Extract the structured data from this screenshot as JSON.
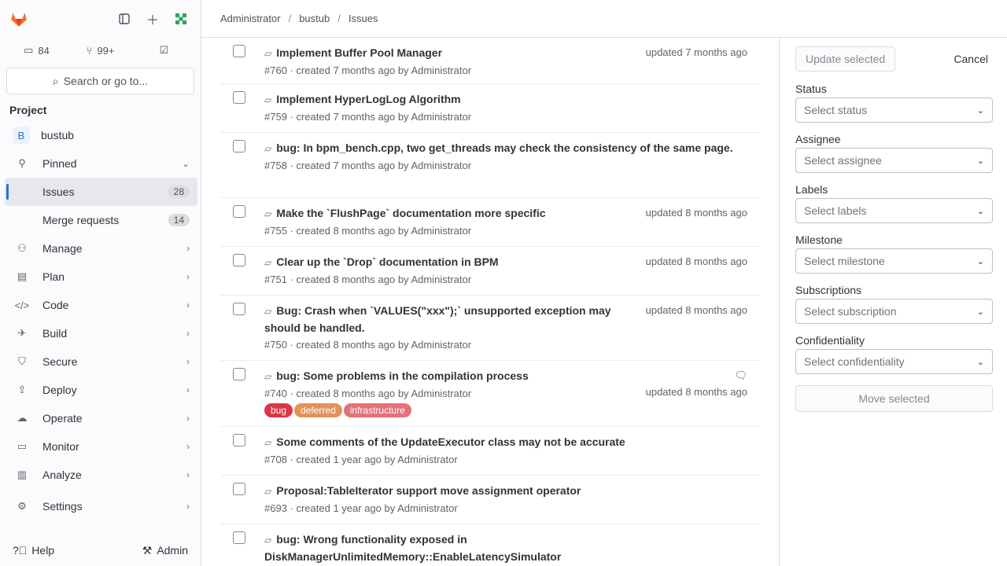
{
  "header": {
    "breadcrumbs": [
      "Administrator",
      "bustub",
      "Issues"
    ]
  },
  "sidebar": {
    "counters": [
      {
        "icon": "issues-icon",
        "value": "84"
      },
      {
        "icon": "merge-request-icon",
        "value": "99+"
      },
      {
        "icon": "todo-icon",
        "value": ""
      }
    ],
    "search_label": "Search or go to...",
    "section_title": "Project",
    "project": {
      "avatar": "B",
      "name": "bustub"
    },
    "items": [
      {
        "label": "Pinned"
      },
      {
        "label": "Issues",
        "badge": "28"
      },
      {
        "label": "Merge requests",
        "badge": "14"
      },
      {
        "label": "Manage"
      },
      {
        "label": "Plan"
      },
      {
        "label": "Code"
      },
      {
        "label": "Build"
      },
      {
        "label": "Secure"
      },
      {
        "label": "Deploy"
      },
      {
        "label": "Operate"
      },
      {
        "label": "Monitor"
      },
      {
        "label": "Analyze"
      },
      {
        "label": "Settings"
      }
    ],
    "help_label": "Help",
    "admin_label": "Admin"
  },
  "issues": [
    {
      "title": "Implement Buffer Pool Manager",
      "meta": "#760 · created 7 months ago by Administrator",
      "updated": "updated 7 months ago"
    },
    {
      "title": "Implement HyperLogLog Algorithm",
      "meta": "#759 · created 7 months ago by Administrator",
      "updated": ""
    },
    {
      "title": "bug: In bpm_bench.cpp, two get_threads may check the consistency of the same page.",
      "meta": "#758 · created 7 months ago by Administrator",
      "updated": ""
    },
    {
      "title": "Make the `FlushPage` documentation more specific",
      "meta": "#755 · created 8 months ago by Administrator",
      "updated": "updated 8 months ago"
    },
    {
      "title": "Clear up the `Drop` documentation in BPM",
      "meta": "#751 · created 8 months ago by Administrator",
      "updated": "updated 8 months ago"
    },
    {
      "title": "Bug: Crash when `VALUES(\"xxx\");` unsupported exception may should be handled.",
      "meta": "#750 · created 8 months ago by Administrator",
      "updated": "updated 8 months ago"
    },
    {
      "title": "bug: Some problems in the compilation process",
      "meta": "#740 · created 8 months ago by Administrator",
      "updated": "updated 8 months ago",
      "labels": [
        {
          "text": "bug",
          "color": "#dc3545"
        },
        {
          "text": "deferred",
          "color": "#e4915c"
        },
        {
          "text": "infrastructure",
          "color": "#e37278"
        }
      ]
    },
    {
      "title": "Some comments of the UpdateExecutor class may not be accurate",
      "meta": "#708 · created 1 year ago by Administrator",
      "updated": ""
    },
    {
      "title": "Proposal:TableIterator support move assignment operator",
      "meta": "#693 · created 1 year ago by Administrator",
      "updated": ""
    },
    {
      "title": "bug: Wrong functionality exposed in DiskManagerUnlimitedMemory::EnableLatencySimulator",
      "meta": "",
      "updated": ""
    }
  ],
  "panel": {
    "update_label": "Update selected",
    "cancel_label": "Cancel",
    "fields": [
      {
        "label": "Status",
        "placeholder": "Select status"
      },
      {
        "label": "Assignee",
        "placeholder": "Select assignee"
      },
      {
        "label": "Labels",
        "placeholder": "Select labels"
      },
      {
        "label": "Milestone",
        "placeholder": "Select milestone"
      },
      {
        "label": "Subscriptions",
        "placeholder": "Select subscription"
      },
      {
        "label": "Confidentiality",
        "placeholder": "Select confidentiality"
      }
    ],
    "move_label": "Move selected"
  },
  "colors": {
    "accent": "#1f75cb",
    "logo": "#e24329"
  }
}
